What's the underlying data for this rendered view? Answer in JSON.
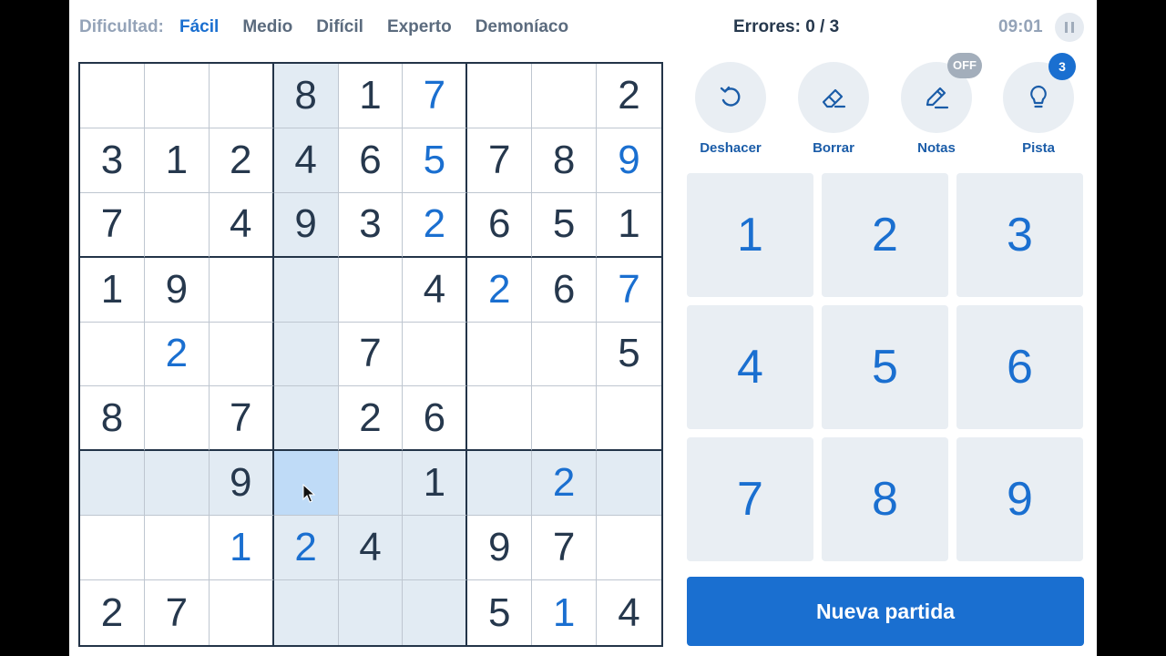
{
  "topbar": {
    "difficulty_label": "Dificultad:",
    "levels": [
      "Fácil",
      "Medio",
      "Difícil",
      "Experto",
      "Demoníaco"
    ],
    "active_level": "Fácil",
    "errors": "Errores: 0 / 3",
    "timer": "09:01"
  },
  "board": {
    "rows": [
      [
        "",
        "",
        "",
        "8",
        "1",
        "7",
        "",
        "",
        "2"
      ],
      [
        "3",
        "1",
        "2",
        "4",
        "6",
        "5",
        "7",
        "8",
        "9"
      ],
      [
        "7",
        "",
        "4",
        "9",
        "3",
        "2",
        "6",
        "5",
        "1"
      ],
      [
        "1",
        "9",
        "",
        "",
        "",
        "4",
        "2",
        "6",
        "7"
      ],
      [
        "",
        "2",
        "",
        "",
        "7",
        "",
        "",
        "",
        "5"
      ],
      [
        "8",
        "",
        "7",
        "",
        "2",
        "6",
        "",
        "",
        ""
      ],
      [
        "",
        "",
        "9",
        "",
        "",
        "1",
        "",
        "2",
        ""
      ],
      [
        "",
        "",
        "1",
        "2",
        "4",
        "",
        "9",
        "7",
        ""
      ],
      [
        "2",
        "7",
        "",
        "",
        "",
        "",
        "5",
        "1",
        "4"
      ]
    ],
    "user_entered": [
      [
        0,
        5
      ],
      [
        1,
        5
      ],
      [
        1,
        8
      ],
      [
        2,
        5
      ],
      [
        3,
        6
      ],
      [
        3,
        8
      ],
      [
        4,
        1
      ],
      [
        6,
        7
      ],
      [
        7,
        2
      ],
      [
        7,
        3
      ],
      [
        8,
        7
      ]
    ],
    "selected": [
      6,
      3
    ]
  },
  "tools": {
    "undo": {
      "label": "Deshacer",
      "icon": "undo-icon"
    },
    "erase": {
      "label": "Borrar",
      "icon": "eraser-icon"
    },
    "notes": {
      "label": "Notas",
      "icon": "pencil-icon",
      "badge": "OFF"
    },
    "hint": {
      "label": "Pista",
      "icon": "lightbulb-icon",
      "badge": "3"
    }
  },
  "numpad": [
    "1",
    "2",
    "3",
    "4",
    "5",
    "6",
    "7",
    "8",
    "9"
  ],
  "new_game_label": "Nueva partida",
  "colors": {
    "accent": "#1a6fd0",
    "highlight": "#e2ebf3",
    "selected": "#bfdbf7",
    "given_digit": "#26384d"
  }
}
